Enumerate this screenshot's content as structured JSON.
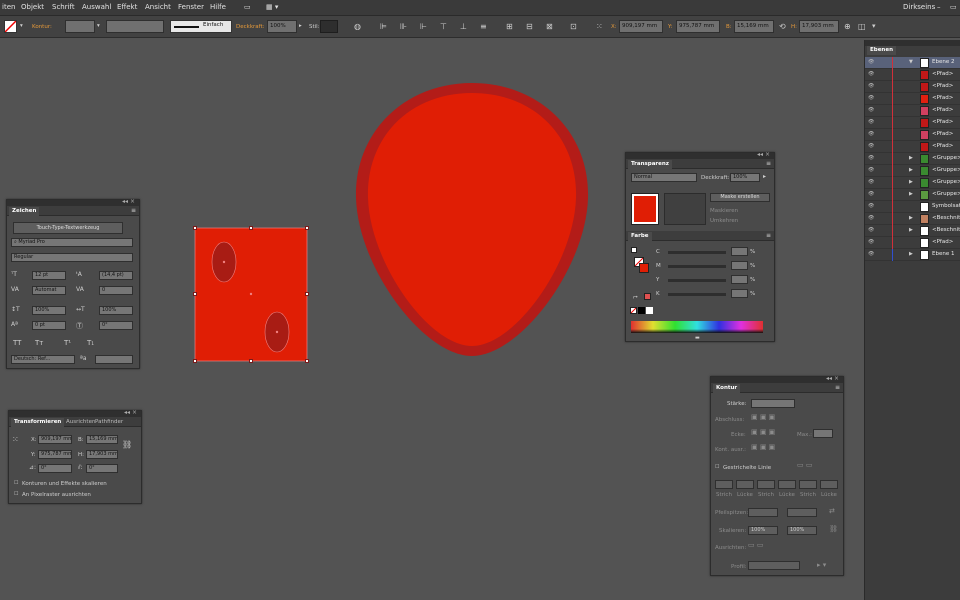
{
  "menu": [
    "iten",
    "Objekt",
    "Schrift",
    "Auswahl",
    "Effekt",
    "Ansicht",
    "Fenster",
    "Hilfe"
  ],
  "workspace": "Dirkseins",
  "control": {
    "kontur_label": "Kontur:",
    "stroke_style": "Einfach",
    "deckkraft_label": "Deckkraft:",
    "deckkraft_value": "100%",
    "stil_label": "Stil:",
    "x_label": "X:",
    "x_value": "909,197 mm",
    "y_label": "Y:",
    "y_value": "975,787 mm",
    "w_label": "B:",
    "w_value": "15,169 mm",
    "h_label": "H:",
    "h_value": "17,903 mm"
  },
  "zeichen": {
    "tab": "Zeichen",
    "touch_type": "Touch-Type-Textwerkzeug",
    "font_family": "Myriad Pro",
    "font_style": "Regular",
    "size": "12 pt",
    "leading": "(14,4 pt)",
    "kerning": "Automat",
    "tracking": "0",
    "vscale": "100%",
    "hscale": "100%",
    "baseline": "0 pt",
    "rotation": "0°",
    "tt_buttons": [
      "TT",
      "Tт",
      "T¹",
      "T₁"
    ],
    "language": "Deutsch: Ref...",
    "aa_label": "ªa"
  },
  "transform": {
    "tabs": [
      "Transformieren",
      "Ausrichten",
      "Pathfinder"
    ],
    "x_label": "X:",
    "x_value": "909,197 mm",
    "y_label": "Y:",
    "y_value": "975,787 mm",
    "w_label": "B:",
    "w_value": "15,169 mm",
    "h_label": "H:",
    "h_value": "17,903 mm",
    "angle": "0°",
    "shear": "0°",
    "scale_strokes": "Konturen und Effekte skalieren",
    "pixel_align": "An Pixelraster ausrichten"
  },
  "transparenz": {
    "tab": "Transparenz",
    "blend_mode": "Normal",
    "opacity_label": "Deckkraft:",
    "opacity_value": "100%",
    "mask_button": "Maske erstellen",
    "clip": "Maskieren",
    "invert": "Umkehren"
  },
  "farbe": {
    "tab": "Farbe",
    "channels": [
      {
        "label": "C",
        "unit": "%"
      },
      {
        "label": "M",
        "unit": "%"
      },
      {
        "label": "Y",
        "unit": "%"
      },
      {
        "label": "K",
        "unit": "%"
      }
    ]
  },
  "kontur": {
    "tab": "Kontur",
    "staerke": "Stärke:",
    "abschluss": "Abschluss:",
    "ecke": "Ecke:",
    "max": "Max.:",
    "kontur_ausrichten": "Kont. ausr.:",
    "gestrichelt": "Gestrichelte Linie",
    "dash_labels": [
      "Strich",
      "Lücke",
      "Strich",
      "Lücke",
      "Strich",
      "Lücke"
    ],
    "pfeilspitzen": "Pfeilspitzen:",
    "skalieren": "Skalieren:",
    "scale1": "100%",
    "scale2": "100%",
    "ausrichten": "Ausrichten:",
    "profil": "Profil:"
  },
  "layers": {
    "tab": "Ebenen",
    "rows": [
      {
        "name": "Ebene 2",
        "thumb": "#ffffff",
        "expand": "▼",
        "selected": true
      },
      {
        "name": "<Pfad>",
        "thumb": "#c01818"
      },
      {
        "name": "<Pfad>",
        "thumb": "#c01818"
      },
      {
        "name": "<Pfad>",
        "thumb": "#e02010"
      },
      {
        "name": "<Pfad>",
        "thumb": "#d04060"
      },
      {
        "name": "<Pfad>",
        "thumb": "#c01818"
      },
      {
        "name": "<Pfad>",
        "thumb": "#d04060"
      },
      {
        "name": "<Pfad>",
        "thumb": "#c01818"
      },
      {
        "name": "<Gruppe>",
        "thumb": "#3a8a30",
        "expand": "▶"
      },
      {
        "name": "<Gruppe>",
        "thumb": "#3a8a30",
        "expand": "▶"
      },
      {
        "name": "<Gruppe>",
        "thumb": "#3a8a30",
        "expand": "▶"
      },
      {
        "name": "<Gruppe>",
        "thumb": "#5a9a40",
        "expand": "▶"
      },
      {
        "name": "Symbolsatz",
        "thumb": "#ffffff"
      },
      {
        "name": "<Beschnittt",
        "thumb": "#c08060",
        "expand": "▶"
      },
      {
        "name": "<Beschnittt",
        "thumb": "#ffffff",
        "expand": "▶"
      },
      {
        "name": "<Pfad>",
        "thumb": "#ffffff"
      },
      {
        "name": "Ebene 1",
        "thumb": "#ffffff",
        "expand": "▶"
      }
    ]
  },
  "colors": {
    "shape_red": "#e01e05",
    "drop_stroke": "#b31c18",
    "ellipse": "#a81c14",
    "app_bg": "#535353"
  }
}
